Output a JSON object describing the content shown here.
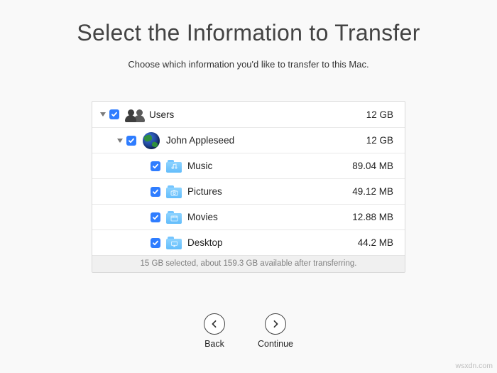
{
  "title": "Select the Information to Transfer",
  "subtitle": "Choose which information you'd like to transfer to this Mac.",
  "tree": {
    "users": {
      "label": "Users",
      "size": "12 GB",
      "checked": true,
      "expanded": true
    },
    "account": {
      "label": "John Appleseed",
      "size": "12 GB",
      "checked": true,
      "expanded": true
    },
    "folders": [
      {
        "name": "Music",
        "size": "89.04 MB",
        "icon": "music",
        "checked": true
      },
      {
        "name": "Pictures",
        "size": "49.12 MB",
        "icon": "camera",
        "checked": true
      },
      {
        "name": "Movies",
        "size": "12.88 MB",
        "icon": "clapper",
        "checked": true
      },
      {
        "name": "Desktop",
        "size": "44.2 MB",
        "icon": "desktop",
        "checked": true
      }
    ]
  },
  "status_line": "15 GB selected, about 159.3 GB available after transferring.",
  "footer": {
    "back": "Back",
    "continue": "Continue"
  },
  "watermark": "wsxdn.com",
  "colors": {
    "accent_checkbox": "#2f7dff",
    "folder_blue": "#6bc2fc"
  }
}
